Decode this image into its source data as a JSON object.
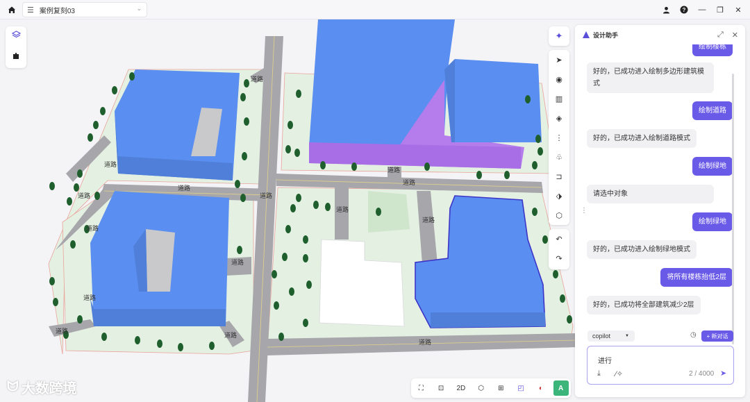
{
  "topbar": {
    "project_name": "案例复刻03",
    "menu_icon": "menu-icon",
    "home_icon": "home-icon",
    "window_icons": [
      "user-icon",
      "help-icon",
      "minimize-icon",
      "restore-icon",
      "close-icon"
    ]
  },
  "scene": {
    "road_label": "道路"
  },
  "right_toolbar": {
    "top_icon": "sparkle-icon",
    "tools": [
      "cursor-icon",
      "location-pin-icon",
      "building-icon",
      "layers-icon",
      "measure-icon",
      "tree-icon",
      "door-icon",
      "plane-icon",
      "box-icon"
    ],
    "history": [
      "undo-icon",
      "redo-icon"
    ]
  },
  "bottom_toolbar": {
    "label_2d": "2D"
  },
  "watermark": {
    "text": "大数跨境"
  },
  "assistant": {
    "title": "设计助手",
    "messages": [
      {
        "role": "user",
        "text": "绘制楼栋"
      },
      {
        "role": "bot",
        "text": "好的，已成功进入绘制多边形建筑模式"
      },
      {
        "role": "user",
        "text": "绘制道路"
      },
      {
        "role": "bot",
        "text": "好的，已成功进入绘制道路模式"
      },
      {
        "role": "user",
        "text": "绘制绿地"
      },
      {
        "role": "bot",
        "text": "请选中对象"
      },
      {
        "role": "user",
        "text": "绘制绿地"
      },
      {
        "role": "bot",
        "text": "好的，已成功进入绘制绿地模式"
      },
      {
        "role": "user",
        "text": "将所有楼栋抬低2层"
      },
      {
        "role": "bot",
        "text": "好的，已成功将全部建筑减少2层"
      }
    ],
    "model_select": "copilot",
    "new_chat_label": "+ 新对话",
    "input_value": "进行",
    "char_count": "2 / 4000",
    "colors": {
      "accent": "#6a5ae8"
    }
  }
}
